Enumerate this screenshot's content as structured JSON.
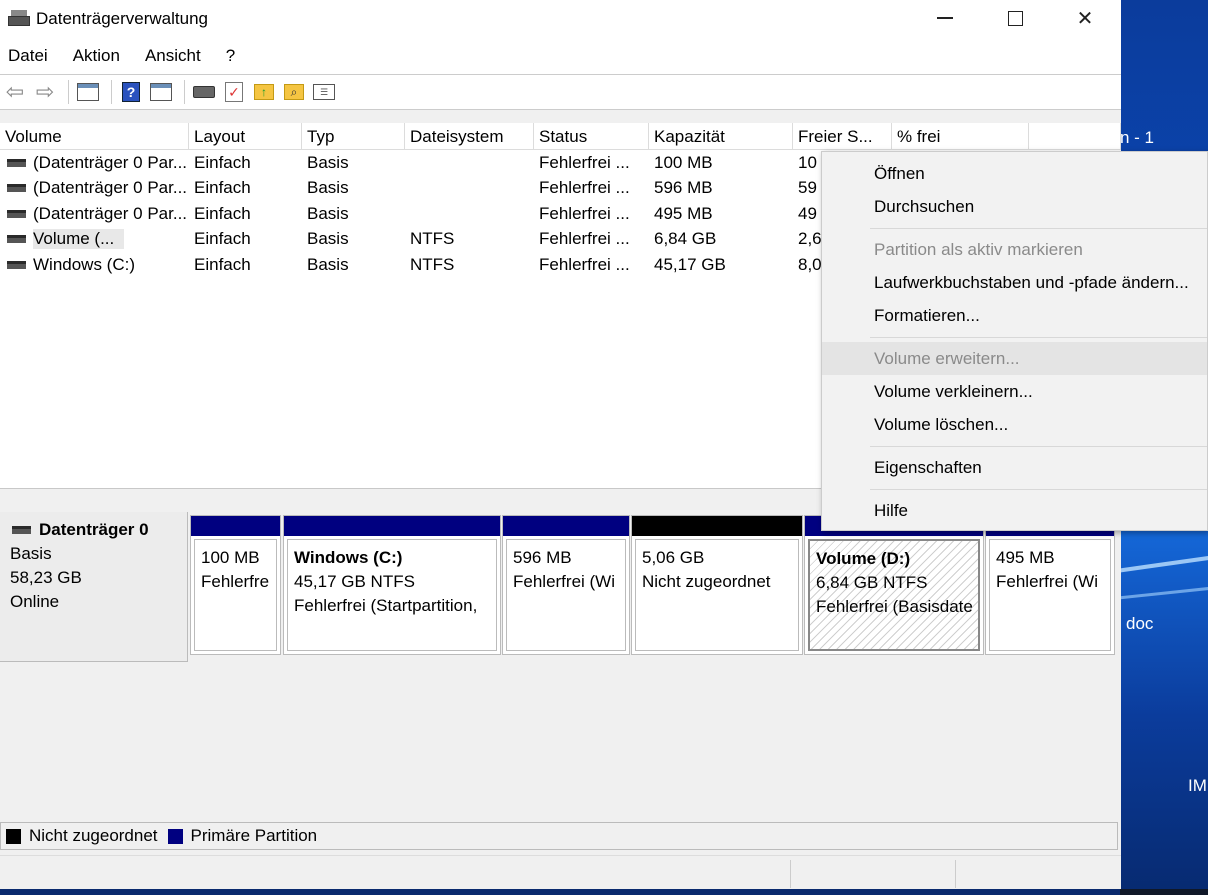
{
  "window": {
    "title": "Datenträgerverwaltung"
  },
  "menubar": {
    "items": [
      "Datei",
      "Aktion",
      "Ansicht",
      "?"
    ]
  },
  "toolbar": {
    "icons": [
      "back-arrow-icon",
      "forward-arrow-icon",
      "console-tree-icon",
      "help-icon",
      "show-pane-icon",
      "connect-drive-icon",
      "checklist-icon",
      "folder-up-icon",
      "search-folder-icon",
      "list-view-icon"
    ]
  },
  "volume_list": {
    "columns": [
      "Volume",
      "Layout",
      "Typ",
      "Dateisystem",
      "Status",
      "Kapazität",
      "Freier S...",
      "% frei",
      ""
    ],
    "rows": [
      {
        "volume": "(Datenträger 0 Par...",
        "layout": "Einfach",
        "typ": "Basis",
        "fs": "",
        "status": "Fehlerfrei ...",
        "cap": "100 MB",
        "free": "10"
      },
      {
        "volume": "(Datenträger 0 Par...",
        "layout": "Einfach",
        "typ": "Basis",
        "fs": "",
        "status": "Fehlerfrei ...",
        "cap": "596 MB",
        "free": "59"
      },
      {
        "volume": "(Datenträger 0 Par...",
        "layout": "Einfach",
        "typ": "Basis",
        "fs": "",
        "status": "Fehlerfrei ...",
        "cap": "495 MB",
        "free": "49"
      },
      {
        "volume": "Volume (...",
        "layout": "Einfach",
        "typ": "Basis",
        "fs": "NTFS",
        "status": "Fehlerfrei ...",
        "cap": "6,84 GB",
        "free": "2,6"
      },
      {
        "volume": "Windows (C:)",
        "layout": "Einfach",
        "typ": "Basis",
        "fs": "NTFS",
        "status": "Fehlerfrei ...",
        "cap": "45,17 GB",
        "free": "8,0"
      }
    ]
  },
  "disk": {
    "name": "Datenträger 0",
    "type": "Basis",
    "size": "58,23 GB",
    "state": "Online",
    "partitions": [
      {
        "name": "",
        "line1": "100 MB",
        "line2": "Fehlerfre",
        "kind": "primary"
      },
      {
        "name": "Windows  (C:)",
        "line1": "45,17 GB NTFS",
        "line2": "Fehlerfrei (Startpartition,",
        "kind": "primary"
      },
      {
        "name": "",
        "line1": "596 MB",
        "line2": "Fehlerfrei (Wi",
        "kind": "primary"
      },
      {
        "name": "",
        "line1": "5,06 GB",
        "line2": "Nicht zugeordnet",
        "kind": "unallocated"
      },
      {
        "name": "Volume  (D:)",
        "line1": "6,84 GB NTFS",
        "line2": "Fehlerfrei (Basisdate",
        "kind": "primary-selected"
      },
      {
        "name": "",
        "line1": "495 MB",
        "line2": "Fehlerfrei (Wi",
        "kind": "primary"
      }
    ]
  },
  "legend": {
    "unallocated": "Nicht zugeordnet",
    "primary": "Primäre Partition",
    "unallocated_color": "#000000",
    "primary_color": "#000080"
  },
  "context_menu": {
    "items": [
      {
        "label": "Öffnen",
        "enabled": true
      },
      {
        "label": "Durchsuchen",
        "enabled": true
      },
      {
        "label": "Partition als aktiv markieren",
        "enabled": false
      },
      {
        "label": "Laufwerkbuchstaben und -pfade ändern...",
        "enabled": true
      },
      {
        "label": "Formatieren...",
        "enabled": true
      },
      {
        "label": "Volume erweitern...",
        "enabled": false
      },
      {
        "label": "Volume verkleinern...",
        "enabled": true
      },
      {
        "label": "Volume löschen...",
        "enabled": true
      },
      {
        "label": "Eigenschaften",
        "enabled": true
      },
      {
        "label": "Hilfe",
        "enabled": true
      }
    ]
  },
  "desktop": {
    "label_top": "n - 1",
    "label_doc": "doc",
    "label_im": "IM"
  }
}
